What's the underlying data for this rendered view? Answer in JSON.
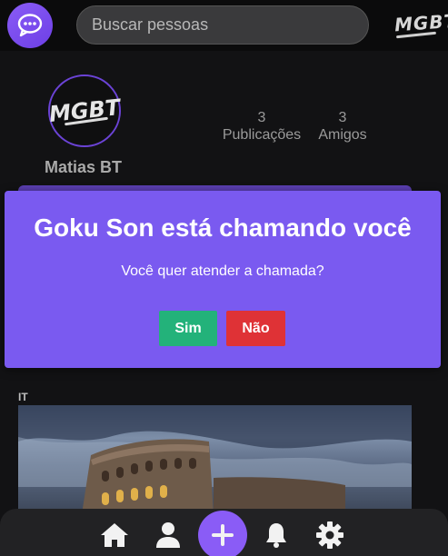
{
  "header": {
    "search_placeholder": "Buscar pessoas",
    "brand": "MGBT",
    "app_icon": "chat-bubble-icon",
    "accent": "#8a5cf6"
  },
  "profile": {
    "avatar_text": "MGBT",
    "name": "Matias BT",
    "stats": [
      {
        "value": "3",
        "label": "Publicações"
      },
      {
        "value": "3",
        "label": "Amigos"
      }
    ]
  },
  "post": {
    "text": "IT"
  },
  "modal": {
    "title": "Goku Son está chamando você",
    "question": "Você quer atender a chamada?",
    "yes_label": "Sim",
    "no_label": "Não",
    "background": "#7a5af0",
    "yes_color": "#23b27a",
    "no_color": "#df3236"
  },
  "bottom_nav": {
    "items": [
      "home-icon",
      "user-icon",
      "plus-icon",
      "bell-icon",
      "gear-icon"
    ]
  }
}
